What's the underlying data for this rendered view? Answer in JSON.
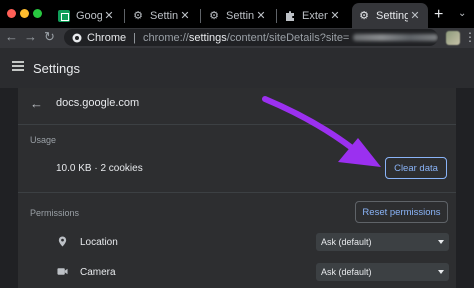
{
  "tabs": [
    {
      "title": "Google S",
      "icon": "google-sheets-icon"
    },
    {
      "title": "Settings",
      "icon": "gear-icon"
    },
    {
      "title": "Settings",
      "icon": "gear-icon"
    },
    {
      "title": "Extension",
      "icon": "puzzle-icon"
    },
    {
      "title": "Settings",
      "icon": "gear-icon",
      "active": true
    }
  ],
  "toolbar": {
    "chip_label": "Chrome",
    "url_prefix": "chrome://",
    "url_bold": "settings",
    "url_rest": "/content/siteDetails?site="
  },
  "header": {
    "title": "Settings"
  },
  "site": {
    "name": "docs.google.com"
  },
  "usage": {
    "section_label": "Usage",
    "text": "10.0 KB · 2 cookies",
    "clear_label": "Clear data"
  },
  "permissions": {
    "section_label": "Permissions",
    "reset_label": "Reset permissions",
    "items": [
      {
        "label": "Location",
        "value": "Ask (default)",
        "icon": "location-pin-icon"
      },
      {
        "label": "Camera",
        "value": "Ask (default)",
        "icon": "camera-icon"
      }
    ]
  },
  "colors": {
    "accent": "#8ab4f8",
    "annotation_arrow": "#9b30f0",
    "background": "#202124",
    "card": "#2d2e30"
  }
}
